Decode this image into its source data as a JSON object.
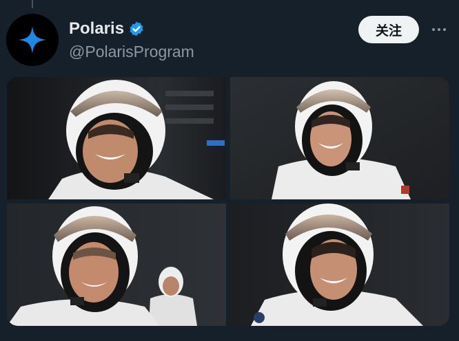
{
  "account": {
    "display_name": "Polaris",
    "handle": "@PolarisProgram",
    "verified_icon": "verified-badge-icon",
    "avatar_icon": "four-point-star-icon"
  },
  "actions": {
    "follow_label": "关注",
    "more_icon": "more-horizontal-icon"
  },
  "media": {
    "photos": [
      {
        "name": "photo-astronaut-1"
      },
      {
        "name": "photo-astronaut-2"
      },
      {
        "name": "photo-astronaut-3"
      },
      {
        "name": "photo-astronaut-4"
      }
    ]
  },
  "colors": {
    "background": "#15202b",
    "verified": "#1d9bf0",
    "star": "#1e88e5",
    "handle": "#8b98a5"
  }
}
